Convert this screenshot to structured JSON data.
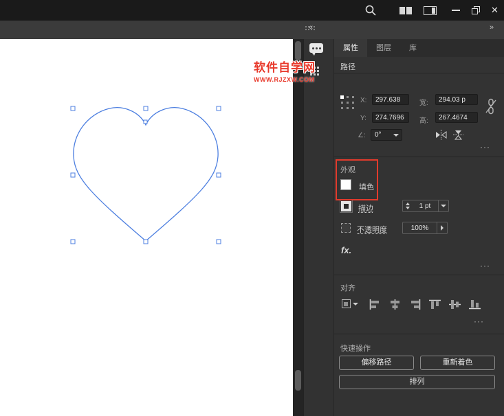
{
  "titlebar": {
    "close_glyph": "✕"
  },
  "menubar": {
    "collapse_left": "«",
    "collapse_right": "»"
  },
  "watermark": {
    "title": "软件自学网",
    "url": "WWW.RJZXW.COM"
  },
  "panel": {
    "tabs": [
      {
        "label": "属性"
      },
      {
        "label": "图层"
      },
      {
        "label": "库"
      }
    ],
    "object_type": "路径",
    "transform": {
      "x_label": "X:",
      "x_value": "297.638",
      "y_label": "Y:",
      "y_value": "274.7696",
      "w_label": "宽:",
      "w_value": "294.03 p",
      "h_label": "高:",
      "h_value": "267.4674",
      "angle_label": "∠:",
      "angle_value": "0°",
      "more": "···"
    },
    "appearance": {
      "title": "外观",
      "fill_label": "填色",
      "stroke_label": "描边",
      "stroke_value": "1 pt",
      "opacity_label": "不透明度",
      "opacity_value": "100%",
      "fx_label": "fx.",
      "more": "···"
    },
    "align": {
      "title": "对齐",
      "more": "···"
    },
    "quick": {
      "title": "快速操作",
      "offset_path": "偏移路径",
      "recolor": "重新着色",
      "arrange": "排列"
    }
  },
  "colors": {
    "annotation_red": "#e23b2c",
    "selection_blue": "#4d7fe0",
    "panel_bg": "#333333",
    "titlebar_bg": "#1a1a1a",
    "canvas_bg": "#ffffff"
  }
}
